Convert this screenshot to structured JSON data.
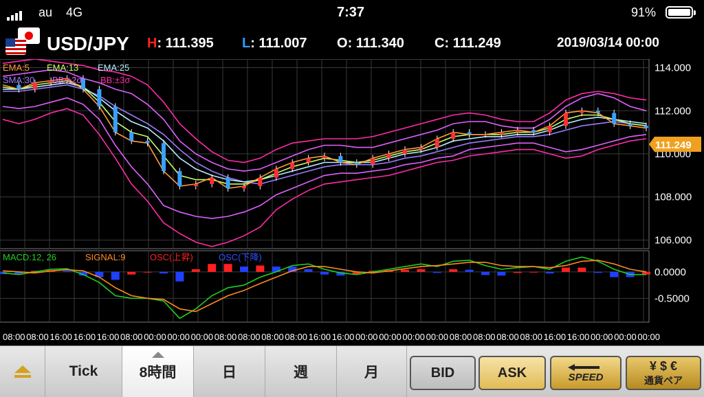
{
  "status_bar": {
    "carrier": "au",
    "network": "4G",
    "time": "7:37",
    "battery": "91%"
  },
  "header": {
    "pair": "USD/JPY",
    "high_key": "H",
    "high": ": 111.395",
    "low_key": "L",
    "low": ": 111.007",
    "open_key": "O",
    "open": ": 111.340",
    "close_key": "C",
    "close": ": 111.249",
    "date": "2019/03/14 00:00"
  },
  "colors": {
    "high": "#ff2020",
    "low": "#2f9bff",
    "current_price_tag": "#f0a020"
  },
  "legend": {
    "ema5": "EMA:5",
    "ema13": "EMA:13",
    "ema25": "EMA:25",
    "sma30": "SMA:30",
    "bb2": "BB:±2σ",
    "bb3": "BB:±3σ"
  },
  "macd_legend": {
    "macd": "MACD:12, 26",
    "signal": "SIGNAL:9",
    "osc_up": "OSC(上昇)",
    "osc_down": "OSC(下降)"
  },
  "chart_data": [
    {
      "type": "line",
      "panel": "price",
      "y_ticks": [
        "114.000",
        "112.000",
        "110.000",
        "108.000",
        "106.000"
      ],
      "ylim": [
        105.6,
        114.4
      ],
      "current_price": "111.249",
      "x_labels": [
        "08:00",
        "08:00",
        "16:00",
        "16:00",
        "16:00",
        "08:00",
        "00:00",
        "00:00",
        "00:00",
        "08:00",
        "08:00",
        "08:00",
        "08:00",
        "16:00",
        "16:00",
        "00:00",
        "00:00",
        "00:00",
        "00:00",
        "08:00",
        "08:00",
        "08:00",
        "08:00",
        "16:00",
        "16:00",
        "00:00",
        "00:00",
        "00:00"
      ],
      "x": [
        0,
        1,
        2,
        3,
        4,
        5,
        6,
        7,
        8,
        9,
        10,
        11,
        12,
        13,
        14,
        15,
        16,
        17,
        18,
        19,
        20,
        21,
        22,
        23,
        24,
        25,
        26,
        27,
        28,
        29,
        30,
        31,
        32,
        33,
        34,
        35,
        36,
        37,
        38,
        39,
        40
      ],
      "series": [
        {
          "name": "EMA:5",
          "color": "#ff9a3c",
          "values": [
            113.2,
            113.0,
            113.3,
            113.4,
            113.5,
            113.0,
            112.2,
            111.0,
            110.6,
            110.5,
            109.2,
            108.5,
            108.6,
            108.9,
            108.4,
            108.5,
            108.9,
            109.3,
            109.6,
            109.8,
            109.9,
            109.6,
            109.5,
            109.8,
            110.0,
            110.2,
            110.3,
            110.7,
            111.0,
            110.9,
            110.9,
            111.0,
            111.1,
            111.0,
            111.3,
            111.9,
            112.0,
            111.9,
            111.4,
            111.3,
            111.2
          ]
        },
        {
          "name": "EMA:13",
          "color": "#c8ff6a",
          "values": [
            113.1,
            113.0,
            113.2,
            113.3,
            113.4,
            113.1,
            112.4,
            111.5,
            111.0,
            110.8,
            109.9,
            109.0,
            108.8,
            108.8,
            108.6,
            108.6,
            108.8,
            109.1,
            109.4,
            109.6,
            109.8,
            109.7,
            109.6,
            109.7,
            109.9,
            110.1,
            110.2,
            110.5,
            110.8,
            110.9,
            110.9,
            110.9,
            111.0,
            111.0,
            111.2,
            111.6,
            111.8,
            111.8,
            111.6,
            111.4,
            111.3
          ]
        },
        {
          "name": "EMA:25",
          "color": "#b5f0ff",
          "values": [
            113.0,
            113.0,
            113.1,
            113.2,
            113.3,
            113.1,
            112.6,
            112.0,
            111.5,
            111.2,
            110.6,
            109.8,
            109.3,
            109.0,
            108.8,
            108.7,
            108.8,
            109.0,
            109.2,
            109.4,
            109.6,
            109.6,
            109.6,
            109.6,
            109.8,
            110.0,
            110.1,
            110.3,
            110.6,
            110.7,
            110.8,
            110.8,
            110.9,
            110.9,
            111.1,
            111.4,
            111.6,
            111.7,
            111.6,
            111.5,
            111.4
          ]
        },
        {
          "name": "SMA:30",
          "color": "#9b7cff",
          "values": [
            112.9,
            112.9,
            113.0,
            113.1,
            113.2,
            113.0,
            112.7,
            112.2,
            111.8,
            111.4,
            110.9,
            110.2,
            109.6,
            109.2,
            108.9,
            108.7,
            108.6,
            108.8,
            109.0,
            109.2,
            109.4,
            109.5,
            109.5,
            109.5,
            109.6,
            109.8,
            109.9,
            110.1,
            110.3,
            110.5,
            110.6,
            110.7,
            110.8,
            110.8,
            110.9,
            111.1,
            111.3,
            111.4,
            111.5,
            111.4,
            111.3
          ]
        },
        {
          "name": "BB:+2σ",
          "color": "#e060ff",
          "values": [
            113.6,
            113.7,
            113.8,
            113.9,
            113.8,
            113.5,
            113.3,
            113.0,
            112.8,
            112.3,
            111.6,
            110.6,
            110.0,
            109.6,
            109.3,
            109.2,
            109.3,
            109.6,
            109.9,
            110.2,
            110.4,
            110.4,
            110.3,
            110.3,
            110.5,
            110.7,
            110.9,
            111.1,
            111.4,
            111.5,
            111.5,
            111.3,
            111.2,
            111.2,
            111.6,
            112.2,
            112.6,
            112.8,
            112.6,
            112.2,
            112.0
          ]
        },
        {
          "name": "BB:-2σ",
          "color": "#e060ff",
          "values": [
            112.2,
            112.1,
            112.2,
            112.4,
            112.6,
            112.3,
            111.6,
            110.4,
            109.4,
            108.6,
            107.6,
            107.3,
            107.1,
            107.0,
            107.1,
            107.3,
            107.6,
            108.1,
            108.4,
            108.7,
            109.0,
            109.1,
            109.1,
            109.2,
            109.3,
            109.5,
            109.6,
            109.8,
            109.9,
            110.2,
            110.3,
            110.4,
            110.5,
            110.5,
            110.3,
            110.1,
            110.2,
            110.4,
            110.6,
            110.8,
            110.9
          ]
        },
        {
          "name": "BB:+3σ",
          "color": "#ff2ca8",
          "values": [
            114.2,
            114.3,
            114.4,
            114.3,
            114.2,
            114.1,
            113.9,
            113.8,
            113.6,
            113.2,
            112.4,
            111.4,
            110.7,
            110.1,
            109.7,
            109.6,
            109.8,
            110.2,
            110.5,
            110.6,
            110.7,
            110.7,
            110.7,
            110.8,
            111.0,
            111.2,
            111.4,
            111.6,
            111.8,
            111.9,
            111.8,
            111.6,
            111.5,
            111.5,
            111.9,
            112.5,
            112.8,
            112.9,
            112.8,
            112.6,
            112.5
          ]
        },
        {
          "name": "BB:-3σ",
          "color": "#ff2ca8",
          "values": [
            111.6,
            111.4,
            111.6,
            111.9,
            112.1,
            111.8,
            110.9,
            109.8,
            108.6,
            107.8,
            106.8,
            106.3,
            105.9,
            105.7,
            105.9,
            106.2,
            106.6,
            107.4,
            107.9,
            108.3,
            108.6,
            108.7,
            108.8,
            108.9,
            109.0,
            109.2,
            109.4,
            109.6,
            109.7,
            109.9,
            110.0,
            110.1,
            110.2,
            110.2,
            110.0,
            109.8,
            109.9,
            110.2,
            110.4,
            110.6,
            110.7
          ]
        }
      ]
    },
    {
      "type": "bar",
      "panel": "macd",
      "y_ticks": [
        "0.0000",
        "-0.5000"
      ],
      "ylim": [
        -0.95,
        0.4
      ],
      "x": [
        0,
        1,
        2,
        3,
        4,
        5,
        6,
        7,
        8,
        9,
        10,
        11,
        12,
        13,
        14,
        15,
        16,
        17,
        18,
        19,
        20,
        21,
        22,
        23,
        24,
        25,
        26,
        27,
        28,
        29,
        30,
        31,
        32,
        33,
        34,
        35,
        36,
        37,
        38,
        39,
        40
      ],
      "series": [
        {
          "name": "MACD:12, 26",
          "color": "#20d020",
          "values": [
            -0.02,
            -0.05,
            0.0,
            0.05,
            0.06,
            -0.05,
            -0.2,
            -0.45,
            -0.5,
            -0.5,
            -0.55,
            -0.88,
            -0.7,
            -0.45,
            -0.3,
            -0.25,
            -0.1,
            0.0,
            0.12,
            0.15,
            0.05,
            -0.02,
            -0.05,
            0.0,
            0.05,
            0.1,
            0.15,
            0.1,
            0.2,
            0.22,
            0.12,
            0.05,
            0.08,
            0.1,
            0.05,
            0.2,
            0.28,
            0.2,
            0.05,
            -0.05,
            -0.05
          ]
        },
        {
          "name": "SIGNAL:9",
          "color": "#ff8a20",
          "values": [
            0.02,
            0.0,
            -0.02,
            0.02,
            0.04,
            0.02,
            -0.1,
            -0.3,
            -0.45,
            -0.5,
            -0.52,
            -0.7,
            -0.75,
            -0.6,
            -0.45,
            -0.35,
            -0.22,
            -0.1,
            0.02,
            0.1,
            0.1,
            0.05,
            0.0,
            -0.02,
            0.02,
            0.06,
            0.1,
            0.12,
            0.15,
            0.18,
            0.18,
            0.12,
            0.1,
            0.1,
            0.08,
            0.12,
            0.2,
            0.22,
            0.15,
            0.05,
            0.0
          ]
        }
      ]
    }
  ],
  "toolbar": {
    "tick": "Tick",
    "h8": "8時間",
    "day": "日",
    "week": "週",
    "month": "月",
    "bid": "BID",
    "ask": "ASK",
    "speed": "SPEED",
    "currency_pair": "通貨ペア"
  }
}
